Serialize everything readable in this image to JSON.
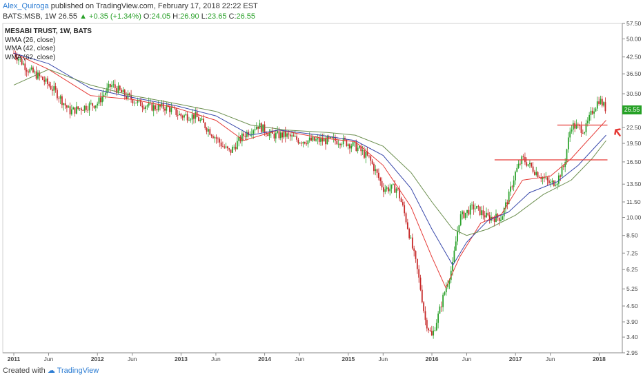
{
  "header": {
    "author": "Alex_Quiroga",
    "published_text": "published on TradingView.com, February 17, 2018 22:22 EST",
    "symbol_line": "BATS:MSB, 1W",
    "last": "26.55",
    "change": "▲ +0.35 (+1.34%)",
    "o_label": "O:",
    "o_val": "24.05",
    "h_label": "H:",
    "h_val": "26.90",
    "l_label": "L:",
    "l_val": "23.65",
    "c_label": "C:",
    "c_val": "26.55"
  },
  "legend": {
    "title": "MESABI TRUST, 1W, BATS",
    "items": [
      "WMA (26, close)",
      "WMA (42, close)",
      "WMA (62, close)"
    ]
  },
  "footer": {
    "created_with": "Created with",
    "brand": "TradingView"
  },
  "colors": {
    "up": "#2aa12a",
    "down": "#c62828",
    "wma26": "#e53935",
    "wma42": "#3949ab",
    "wma62": "#6b8e4e",
    "hline": "#e53935"
  },
  "chart_data": {
    "type": "candlestick",
    "title": "MESABI TRUST, 1W, BATS",
    "y_scale": "log",
    "ylim": [
      2.85,
      57.5
    ],
    "y_ticks": [
      "57.50",
      "50.00",
      "42.50",
      "36.50",
      "30.50",
      "26.55",
      "22.50",
      "19.50",
      "16.50",
      "13.50",
      "11.50",
      "10.00",
      "8.50",
      "7.25",
      "6.25",
      "5.25",
      "4.50",
      "3.90",
      "3.40",
      "2.95"
    ],
    "x_ticks": [
      "2011",
      "Jun",
      "2012",
      "Jun",
      "2013",
      "Jun",
      "2014",
      "Jun",
      "2015",
      "Jun",
      "2016",
      "Jun",
      "2017",
      "Jun",
      "2018"
    ],
    "last_price": "26.55",
    "horizontal_lines": [
      {
        "value": 23.0,
        "from": "2017-07",
        "to": "2018-02"
      },
      {
        "value": 16.8,
        "from": "2016-10",
        "to": "2018-02"
      }
    ],
    "series": [
      {
        "name": "MESABI TRUST",
        "kind": "close",
        "points": [
          [
            "2011-01",
            44
          ],
          [
            "2011-03",
            38
          ],
          [
            "2011-05",
            35
          ],
          [
            "2011-07",
            31
          ],
          [
            "2011-09",
            26
          ],
          [
            "2011-11",
            27
          ],
          [
            "2012-01",
            28
          ],
          [
            "2012-03",
            33
          ],
          [
            "2012-05",
            30
          ],
          [
            "2012-07",
            28
          ],
          [
            "2012-09",
            27
          ],
          [
            "2012-11",
            27
          ],
          [
            "2013-01",
            25
          ],
          [
            "2013-03",
            25
          ],
          [
            "2013-05",
            22
          ],
          [
            "2013-07",
            19
          ],
          [
            "2013-08",
            18
          ],
          [
            "2013-10",
            21
          ],
          [
            "2013-12",
            23
          ],
          [
            "2014-02",
            21
          ],
          [
            "2014-04",
            21
          ],
          [
            "2014-06",
            20
          ],
          [
            "2014-08",
            20
          ],
          [
            "2014-10",
            20
          ],
          [
            "2014-12",
            20
          ],
          [
            "2015-02",
            19
          ],
          [
            "2015-04",
            17
          ],
          [
            "2015-06",
            13
          ],
          [
            "2015-08",
            13
          ],
          [
            "2015-10",
            8
          ],
          [
            "2015-12",
            4
          ],
          [
            "2016-01",
            3.4
          ],
          [
            "2016-02",
            4.2
          ],
          [
            "2016-03",
            5.3
          ],
          [
            "2016-04",
            6.5
          ],
          [
            "2016-05",
            10
          ],
          [
            "2016-07",
            11
          ],
          [
            "2016-09",
            10
          ],
          [
            "2016-11",
            10
          ],
          [
            "2016-12",
            12
          ],
          [
            "2017-01",
            15
          ],
          [
            "2017-02",
            17
          ],
          [
            "2017-04",
            15
          ],
          [
            "2017-06",
            13.5
          ],
          [
            "2017-07",
            14
          ],
          [
            "2017-08",
            16
          ],
          [
            "2017-09",
            23
          ],
          [
            "2017-11",
            22
          ],
          [
            "2017-12",
            26
          ],
          [
            "2018-01",
            29
          ],
          [
            "2018-02",
            26.55
          ]
        ]
      },
      {
        "name": "WMA (26, close)",
        "points": [
          [
            "2011-01",
            44
          ],
          [
            "2011-06",
            38
          ],
          [
            "2011-12",
            30
          ],
          [
            "2012-06",
            29
          ],
          [
            "2012-12",
            27
          ],
          [
            "2013-06",
            24
          ],
          [
            "2013-10",
            20
          ],
          [
            "2014-03",
            22
          ],
          [
            "2014-09",
            20.5
          ],
          [
            "2015-02",
            19.8
          ],
          [
            "2015-06",
            16
          ],
          [
            "2015-10",
            11
          ],
          [
            "2016-01",
            7
          ],
          [
            "2016-03",
            5.3
          ],
          [
            "2016-05",
            7
          ],
          [
            "2016-08",
            9.5
          ],
          [
            "2016-11",
            10.3
          ],
          [
            "2017-02",
            14
          ],
          [
            "2017-06",
            14.5
          ],
          [
            "2017-09",
            17
          ],
          [
            "2018-02",
            24
          ]
        ]
      },
      {
        "name": "WMA (42, close)",
        "points": [
          [
            "2011-01",
            44
          ],
          [
            "2011-06",
            40
          ],
          [
            "2011-12",
            32
          ],
          [
            "2012-06",
            29.5
          ],
          [
            "2012-12",
            27.5
          ],
          [
            "2013-06",
            25
          ],
          [
            "2013-11",
            21
          ],
          [
            "2014-03",
            22
          ],
          [
            "2014-09",
            21
          ],
          [
            "2015-02",
            20
          ],
          [
            "2015-06",
            17.5
          ],
          [
            "2015-10",
            13
          ],
          [
            "2016-01",
            9
          ],
          [
            "2016-04",
            6.5
          ],
          [
            "2016-06",
            8
          ],
          [
            "2016-09",
            9.7
          ],
          [
            "2016-12",
            10.5
          ],
          [
            "2017-03",
            12.5
          ],
          [
            "2017-07",
            13.8
          ],
          [
            "2017-10",
            16
          ],
          [
            "2018-02",
            21
          ]
        ]
      },
      {
        "name": "WMA (62, close)",
        "points": [
          [
            "2011-01",
            33
          ],
          [
            "2011-06",
            38
          ],
          [
            "2011-12",
            33
          ],
          [
            "2012-06",
            30
          ],
          [
            "2012-12",
            28
          ],
          [
            "2013-06",
            26
          ],
          [
            "2013-11",
            23
          ],
          [
            "2014-04",
            22
          ],
          [
            "2014-10",
            21.5
          ],
          [
            "2015-02",
            21
          ],
          [
            "2015-06",
            19
          ],
          [
            "2015-10",
            15
          ],
          [
            "2016-01",
            11.5
          ],
          [
            "2016-04",
            9
          ],
          [
            "2016-06",
            8.5
          ],
          [
            "2016-09",
            9
          ],
          [
            "2017-01",
            10.2
          ],
          [
            "2017-05",
            12.3
          ],
          [
            "2017-09",
            14
          ],
          [
            "2017-12",
            17
          ],
          [
            "2018-02",
            20
          ]
        ]
      }
    ]
  }
}
